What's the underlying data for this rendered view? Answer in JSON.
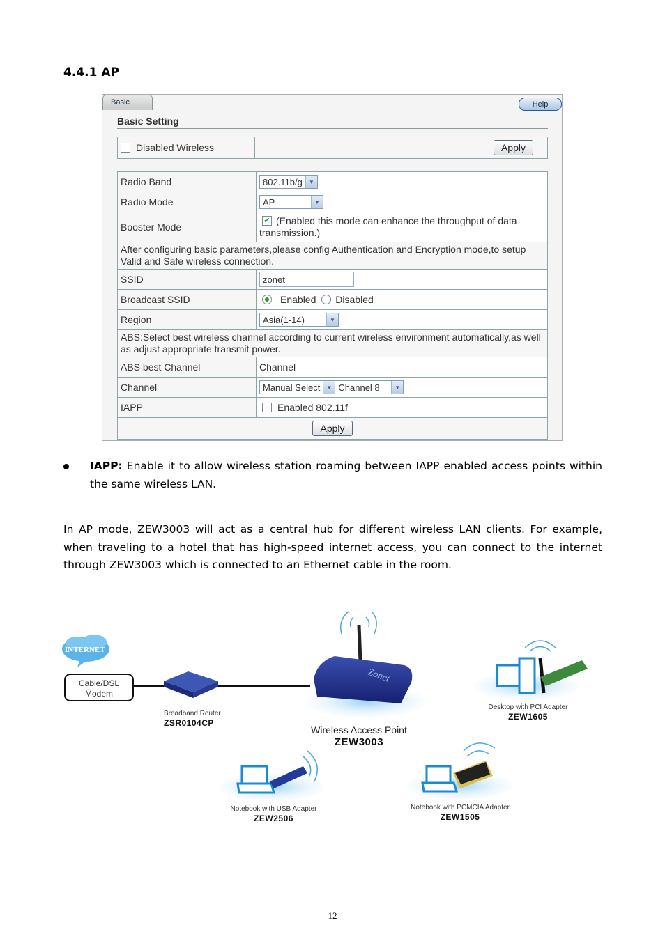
{
  "section_heading": "4.4.1 AP",
  "ui": {
    "tab_basic": "Basic",
    "help_button": "Help",
    "section_title": "Basic Setting",
    "disabled_wireless_label": "Disabled Wireless",
    "disabled_wireless_checked": false,
    "top_apply_button": "Apply",
    "rows": {
      "radio_band": {
        "label": "Radio Band",
        "value": "802.11b/g"
      },
      "radio_mode": {
        "label": "Radio Mode",
        "value": "AP"
      },
      "booster_mode": {
        "label": "Booster Mode",
        "checked": true,
        "description": "(Enabled this mode can enhance the throughput of data transmission.)"
      },
      "config_note": "After configuring basic parameters,please config Authentication and Encryption mode,to setup Valid and Safe wireless connection.",
      "ssid": {
        "label": "SSID",
        "value": "zonet"
      },
      "broadcast_ssid": {
        "label": "Broadcast SSID",
        "options": [
          "Enabled",
          "Disabled"
        ],
        "selected": "Enabled"
      },
      "region": {
        "label": "Region",
        "value": "Asia(1-14)"
      },
      "abs_note": "ABS:Select best wireless channel according to current wireless environment automatically,as well as adjust appropriate transmit power.",
      "abs_best_channel": {
        "label": "ABS best Channel",
        "value": "Channel"
      },
      "channel": {
        "label": "Channel",
        "mode": "Manual Select",
        "value": "Channel 8"
      },
      "iapp": {
        "label": "IAPP",
        "checked": false,
        "option_label": "Enabled 802.11f"
      }
    },
    "bottom_apply_button": "Apply"
  },
  "bullet": {
    "term": "IAPP:",
    "text": " Enable it to allow wireless station roaming between IAPP enabled access points within the same wireless LAN."
  },
  "paragraph": "In AP mode, ZEW3003 will act as a central hub for different wireless LAN clients. For example, when traveling to a hotel that has high-speed internet access, you can connect to the internet through ZEW3003 which is connected to an Ethernet cable in the room.",
  "diagram": {
    "internet": "INTERNET",
    "modem_line1": "Cable/DSL",
    "modem_line2": "Modem",
    "router_label": "Broadband Router",
    "router_model": "ZSR0104CP",
    "ap_label": "Wireless Access Point",
    "ap_model": "ZEW3003",
    "desktop_label": "Desktop with PCI Adapter",
    "desktop_model": "ZEW1605",
    "usb_label": "Notebook with USB Adapter",
    "usb_model": "ZEW2506",
    "pcmcia_label": "Notebook with PCMCIA Adapter",
    "pcmcia_model": "ZEW1505",
    "brand": "Zonet"
  },
  "page_number": "12"
}
